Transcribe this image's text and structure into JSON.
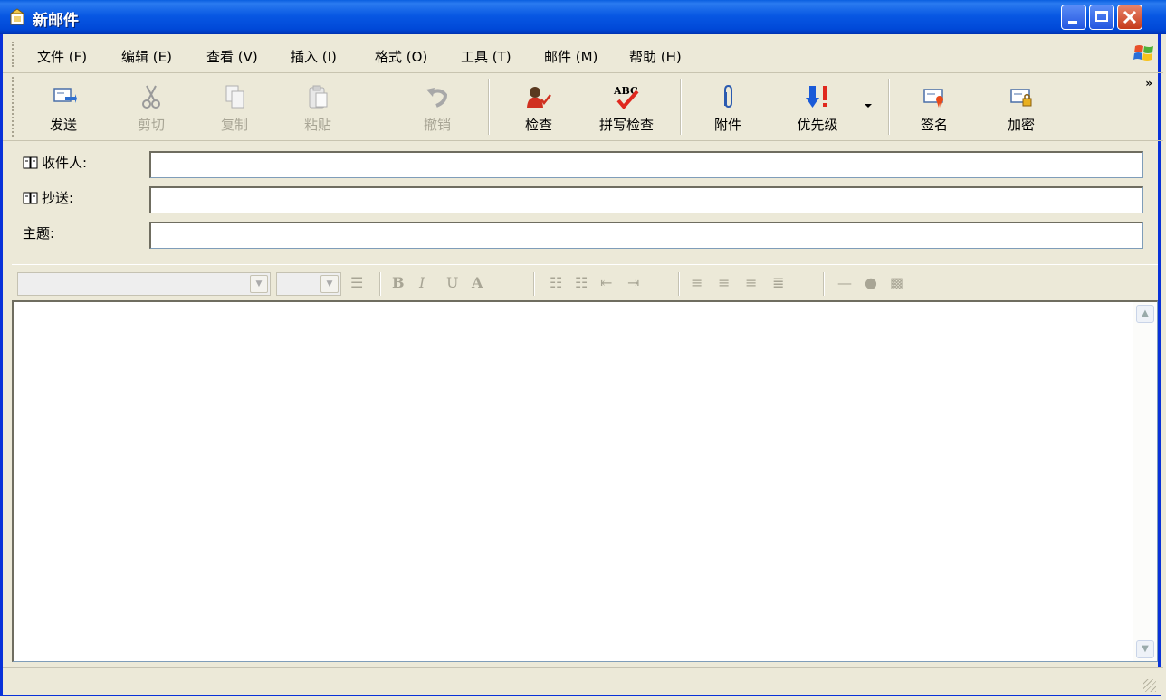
{
  "window": {
    "title": "新邮件",
    "buttons": {
      "minimize": "minimize",
      "maximize": "maximize",
      "close": "close"
    }
  },
  "menu": [
    "文件 (F)",
    "编辑 (E)",
    "查看 (V)",
    "插入 (I)",
    "格式 (O)",
    "工具 (T)",
    "邮件 (M)",
    "帮助 (H)"
  ],
  "toolbar": {
    "send": "发送",
    "cut": "剪切",
    "copy": "复制",
    "paste": "粘贴",
    "undo": "撤销",
    "check": "检查",
    "spellcheck": "拼写检查",
    "spell_icon_text": "ABC",
    "attach": "附件",
    "priority": "优先级",
    "sign": "签名",
    "encrypt": "加密",
    "more": "»"
  },
  "header": {
    "to_label": "收件人:",
    "cc_label": "抄送:",
    "subject_label": "主题:",
    "to_value": "",
    "cc_value": "",
    "subject_value": ""
  },
  "format": {
    "font": "",
    "size": "",
    "bold": "B",
    "italic": "I",
    "underline": "U",
    "color": "A"
  },
  "body": {
    "text": ""
  },
  "colors": {
    "titlebar": "#0858e3",
    "chrome": "#ece9d8",
    "disabled": "#a8a595",
    "spell_check_mark": "#e0281e",
    "priority_arrow": "#1a5ad8"
  }
}
